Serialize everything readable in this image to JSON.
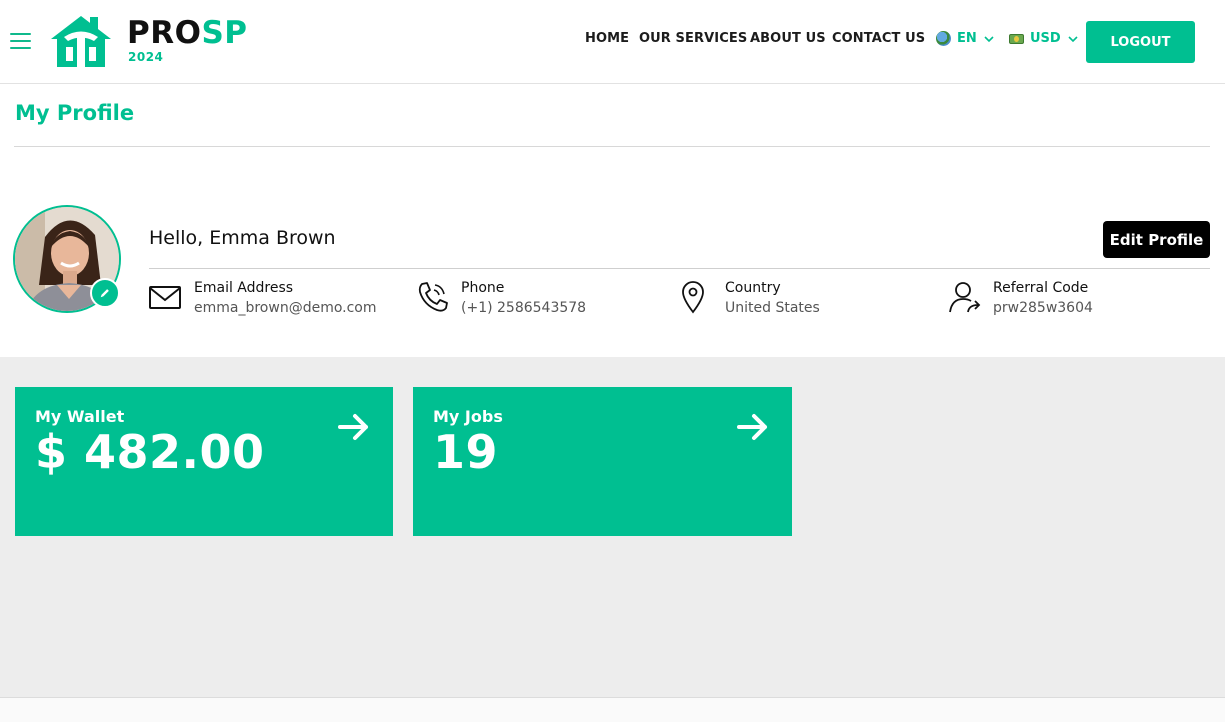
{
  "header": {
    "brand_pro": "PRO",
    "brand_sp": "SP",
    "brand_year": "2024",
    "nav": {
      "home": "HOME",
      "services": "OUR SERVICES",
      "about": "ABOUT US",
      "contact": "CONTACT US"
    },
    "language": "EN",
    "currency": "USD",
    "logout_label": "LOGOUT"
  },
  "profile": {
    "page_title": "My Profile",
    "greeting": "Hello, Emma Brown",
    "edit_label": "Edit Profile",
    "info": [
      {
        "label": "Email Address",
        "value": "emma_brown@demo.com",
        "icon": "envelope-icon"
      },
      {
        "label": "Phone",
        "value": "(+1) 2586543578",
        "icon": "phone-icon"
      },
      {
        "label": "Country",
        "value": "United States",
        "icon": "map-pin-icon"
      },
      {
        "label": "Referral Code",
        "value": "prw285w3604",
        "icon": "user-share-icon"
      }
    ]
  },
  "cards": {
    "wallet": {
      "title": "My Wallet",
      "value": "$ 482.00"
    },
    "jobs": {
      "title": "My Jobs",
      "value": "19"
    }
  },
  "colors": {
    "accent": "#00bf91",
    "background": "#ededed",
    "edit_button": "#000000"
  }
}
